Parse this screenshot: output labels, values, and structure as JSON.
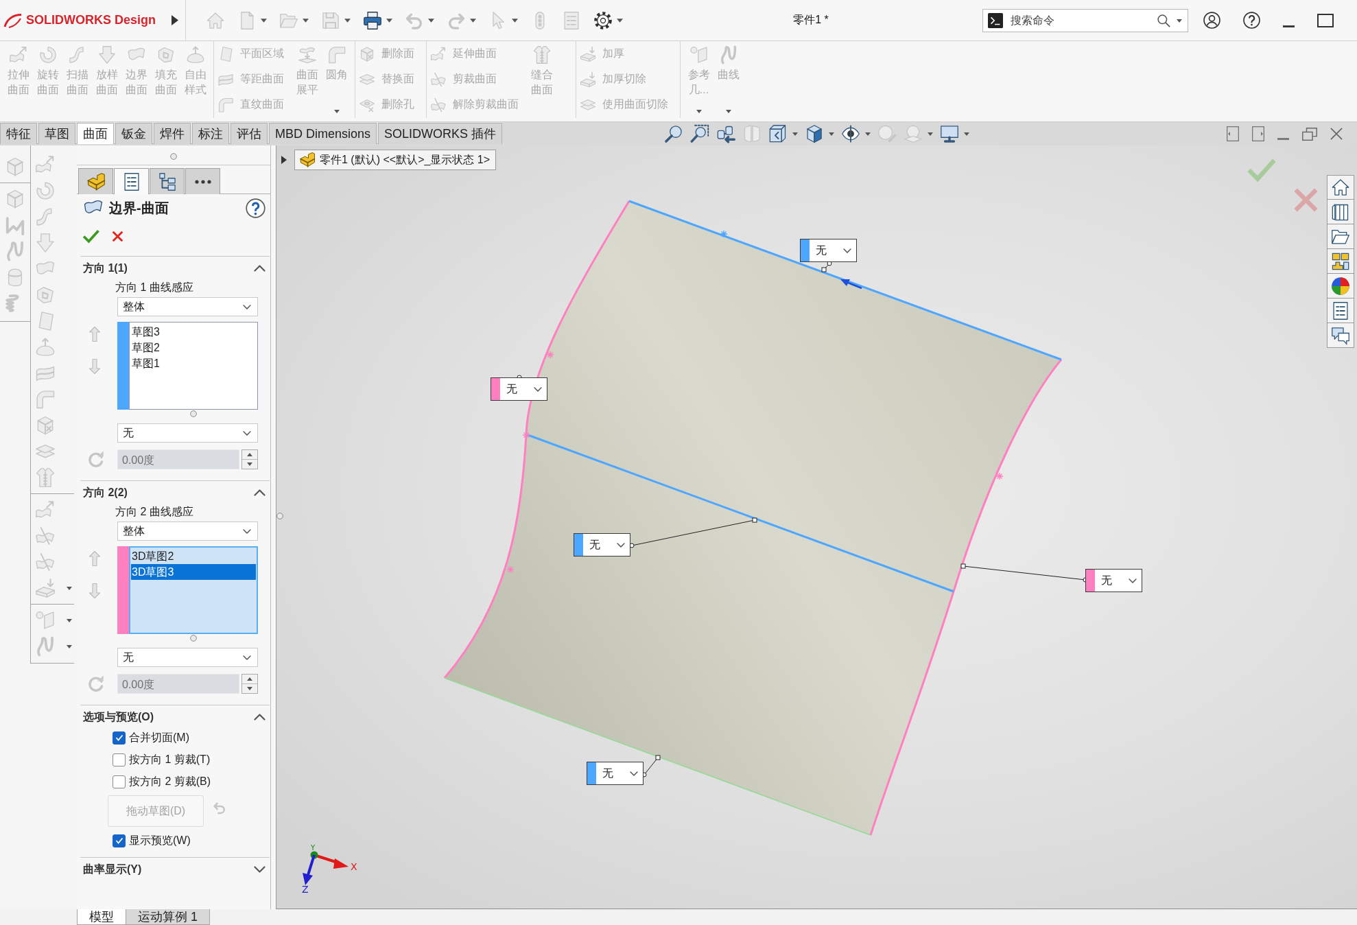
{
  "titlebar": {
    "logo": "**SOLID**WORKS Design",
    "quick_access": [
      {
        "kind": "home",
        "disabled": true,
        "menu": false
      },
      {
        "kind": "new",
        "disabled": true,
        "menu": true
      },
      {
        "kind": "open",
        "disabled": true,
        "menu": true
      },
      {
        "kind": "save",
        "disabled": true,
        "menu": true
      },
      {
        "kind": "print",
        "disabled": false,
        "menu": true
      },
      {
        "kind": "undo",
        "disabled": true,
        "menu": true
      },
      {
        "kind": "redo",
        "disabled": true,
        "menu": true
      },
      {
        "kind": "select",
        "disabled": true,
        "menu": true
      },
      {
        "kind": "rebuild",
        "disabled": true,
        "menu": false
      },
      {
        "kind": "properties",
        "disabled": true,
        "menu": false
      },
      {
        "kind": "options",
        "disabled": false,
        "menu": true
      }
    ],
    "document_title": "零件1 *",
    "search": {
      "placeholder": "搜索命令"
    }
  },
  "ribbon": {
    "groups": [
      {
        "large": [
          {
            "kind": "extrude",
            "label": "拉伸曲面",
            "disabled": true,
            "menu": false
          },
          {
            "kind": "revolve",
            "label": "旋转曲面",
            "disabled": true,
            "menu": false
          },
          {
            "kind": "sweep",
            "label": "扫描曲面",
            "disabled": true,
            "menu": false
          },
          {
            "kind": "loft",
            "label": "放样曲面",
            "disabled": true,
            "menu": false
          },
          {
            "kind": "boundary",
            "label": "边界曲面",
            "disabled": true,
            "menu": false
          },
          {
            "kind": "fill",
            "label": "填充曲面",
            "disabled": true,
            "menu": false
          },
          {
            "kind": "freeform",
            "label": "自由样式",
            "disabled": true,
            "menu": false
          }
        ]
      },
      {
        "small": [
          {
            "kind": "planar",
            "label": "平面区域",
            "disabled": true
          },
          {
            "kind": "offset",
            "label": "等距曲面",
            "disabled": true
          },
          {
            "kind": "ruled",
            "label": "直纹曲面",
            "disabled": true
          }
        ],
        "large": [
          {
            "kind": "flatten",
            "label": "曲面展平",
            "disabled": true,
            "menu": false
          },
          {
            "kind": "fillet",
            "label": "圆角",
            "disabled": true,
            "menu": true
          }
        ]
      },
      {
        "small": [
          {
            "kind": "delete-face",
            "label": "删除面",
            "disabled": true
          },
          {
            "kind": "replace-face",
            "label": "替换面",
            "disabled": true
          },
          {
            "kind": "delete-hole",
            "label": "删除孔",
            "disabled": true
          }
        ]
      },
      {
        "small": [
          {
            "kind": "extend",
            "label": "延伸曲面",
            "disabled": true
          },
          {
            "kind": "trim",
            "label": "剪裁曲面",
            "disabled": true
          },
          {
            "kind": "untrim",
            "label": "解除剪裁曲面",
            "disabled": true
          }
        ],
        "large": [
          {
            "kind": "knit",
            "label": "缝合曲面",
            "disabled": true,
            "menu": false
          }
        ]
      },
      {
        "small": [
          {
            "kind": "thicken",
            "label": "加厚",
            "disabled": true
          },
          {
            "kind": "thicken-cut",
            "label": "加厚切除",
            "disabled": true
          },
          {
            "kind": "surface-cut",
            "label": "使用曲面切除",
            "disabled": true
          }
        ]
      },
      {
        "large": [
          {
            "kind": "reference",
            "label": "参考几...",
            "disabled": true,
            "menu": true
          },
          {
            "kind": "curve",
            "label": "曲线",
            "disabled": true,
            "menu": true
          }
        ]
      }
    ]
  },
  "command_tabs": [
    {
      "label": "特征",
      "selected": false
    },
    {
      "label": "草图",
      "selected": false
    },
    {
      "label": "曲面",
      "selected": true
    },
    {
      "label": "钣金",
      "selected": false
    },
    {
      "label": "焊件",
      "selected": false
    },
    {
      "label": "标注",
      "selected": false
    },
    {
      "label": "评估",
      "selected": false
    },
    {
      "label": "MBD Dimensions",
      "selected": false
    },
    {
      "label": "SOLIDWORKS 插件",
      "selected": false
    }
  ],
  "view_toolbar": [
    {
      "kind": "zoom-fit",
      "disabled": false,
      "menu": false
    },
    {
      "kind": "zoom-area",
      "disabled": false,
      "menu": false
    },
    {
      "kind": "previous-view",
      "disabled": false,
      "menu": false
    },
    {
      "kind": "section-view",
      "disabled": true,
      "menu": false
    },
    {
      "kind": "orientation",
      "disabled": false,
      "menu": true
    },
    {
      "kind": "display-style",
      "disabled": false,
      "menu": true
    },
    {
      "kind": "hide-show",
      "disabled": false,
      "menu": true
    },
    {
      "kind": "appearance",
      "disabled": true,
      "menu": false
    },
    {
      "kind": "scene",
      "disabled": true,
      "menu": true
    },
    {
      "kind": "view-settings",
      "disabled": false,
      "menu": true
    }
  ],
  "feature_strips": [
    {
      "disabled": true,
      "groups": [
        {
          "items": [
            {
              "kind": "solid",
              "menu": false
            }
          ]
        },
        {
          "items": [
            {
              "kind": "box",
              "menu": false
            },
            {
              "kind": "sketch",
              "menu": false
            },
            {
              "kind": "curve",
              "menu": false
            },
            {
              "kind": "rounded-box",
              "menu": false
            },
            {
              "kind": "helix",
              "menu": false
            }
          ]
        }
      ]
    },
    {
      "disabled": true,
      "groups": [
        {
          "items": [
            {
              "kind": "extrude",
              "menu": false
            },
            {
              "kind": "revolve",
              "menu": false
            },
            {
              "kind": "sweep",
              "menu": false
            },
            {
              "kind": "loft",
              "menu": false
            },
            {
              "kind": "boundary",
              "menu": false
            },
            {
              "kind": "fill",
              "menu": false
            },
            {
              "kind": "planar",
              "menu": false
            },
            {
              "kind": "freeform",
              "menu": false
            },
            {
              "kind": "offset",
              "menu": false
            },
            {
              "kind": "ruled",
              "menu": false
            },
            {
              "kind": "delete-face",
              "menu": false
            },
            {
              "kind": "replace-face",
              "menu": false
            },
            {
              "kind": "knit",
              "menu": false
            }
          ]
        },
        {
          "items": [
            {
              "kind": "extend",
              "menu": false
            },
            {
              "kind": "trim",
              "menu": false
            },
            {
              "kind": "untrim",
              "menu": false
            },
            {
              "kind": "thicken",
              "menu": true
            }
          ]
        },
        {
          "items": [
            {
              "kind": "reference",
              "menu": true
            },
            {
              "kind": "curve",
              "menu": true
            }
          ]
        }
      ]
    }
  ],
  "property_manager": {
    "tabs": [
      {
        "kind": "feature-tree",
        "selected": false
      },
      {
        "kind": "property-manager",
        "selected": true
      },
      {
        "kind": "configuration",
        "selected": false
      },
      {
        "kind": "more",
        "selected": false
      }
    ],
    "title": "边界-曲面",
    "sections": [
      {
        "kind": "direction",
        "title": "方向 1(1)",
        "expanded": true,
        "curve_influence_label": "方向 1 曲线感应",
        "curve_influence": "整体",
        "color": "#4da6ff",
        "focused": false,
        "curves": [
          {
            "label": "草图3",
            "selected": false
          },
          {
            "label": "草图2",
            "selected": false
          },
          {
            "label": "草图1",
            "selected": false
          }
        ],
        "tangency_type": "无",
        "draft_angle": {
          "value": "0.00度",
          "disabled": true
        }
      },
      {
        "kind": "direction",
        "title": "方向 2(2)",
        "expanded": true,
        "curve_influence_label": "方向 2 曲线感应",
        "curve_influence": "整体",
        "color": "#ff80c0",
        "focused": true,
        "curves": [
          {
            "label": "3D草图2",
            "selected": false
          },
          {
            "label": "3D草图3",
            "selected": true
          }
        ],
        "tangency_type": "无",
        "draft_angle": {
          "value": "0.00度",
          "disabled": true
        }
      },
      {
        "kind": "options",
        "title": "选项与预览(O)",
        "expanded": true,
        "items": [
          {
            "kind": "checkbox",
            "label": "合并切面(M)",
            "checked": true,
            "disabled": false
          },
          {
            "kind": "checkbox",
            "label": "按方向 1 剪裁(T)",
            "checked": false,
            "disabled": false
          },
          {
            "kind": "checkbox",
            "label": "按方向 2 剪裁(B)",
            "checked": false,
            "disabled": false
          },
          {
            "kind": "button",
            "label": "拖动草图(D)",
            "disabled": true
          },
          {
            "kind": "checkbox",
            "label": "显示预览(W)",
            "checked": true,
            "disabled": false
          }
        ]
      },
      {
        "kind": "options",
        "title": "曲率显示(Y)",
        "expanded": false
      }
    ]
  },
  "graphics": {
    "breadcrumb": "零件1 (默认) <<默认>_显示状态 1>",
    "callouts": [
      {
        "value": "无",
        "color": "#4da6ff"
      },
      {
        "value": "无",
        "color": "#ff80c0"
      },
      {
        "value": "无",
        "color": "#4da6ff"
      },
      {
        "value": "无",
        "color": "#ff80c0"
      },
      {
        "value": "无",
        "color": "#4da6ff"
      }
    ],
    "axes": [
      {
        "label": "X",
        "color": "#e01818"
      },
      {
        "label": "Y",
        "color": "#1a8a1a"
      },
      {
        "label": "Z",
        "color": "#2020d0"
      }
    ],
    "task_pane": [
      {
        "kind": "home"
      },
      {
        "kind": "library"
      },
      {
        "kind": "explorer"
      },
      {
        "kind": "view-palette"
      },
      {
        "kind": "appearances"
      },
      {
        "kind": "properties"
      },
      {
        "kind": "forum"
      }
    ]
  },
  "bottom_tabs": [
    {
      "label": "模型",
      "selected": true
    },
    {
      "label": "运动算例 1",
      "selected": false
    }
  ]
}
